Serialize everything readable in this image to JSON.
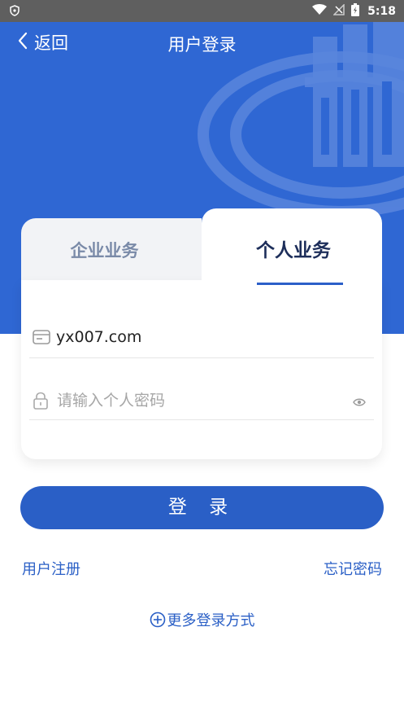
{
  "status_bar": {
    "time": "5:18"
  },
  "nav": {
    "back_label": "返回",
    "title": "用户登录"
  },
  "tabs": [
    {
      "label": "企业业务",
      "active": false
    },
    {
      "label": "个人业务",
      "active": true
    }
  ],
  "form": {
    "account_value": "yx007.com",
    "password_placeholder": "请输入个人密码"
  },
  "login_button": "登 录",
  "links": {
    "register": "用户注册",
    "forgot": "忘记密码"
  },
  "more_login": "更多登录方式",
  "colors": {
    "primary": "#2a5fc6",
    "hero": "#2f67d3"
  }
}
